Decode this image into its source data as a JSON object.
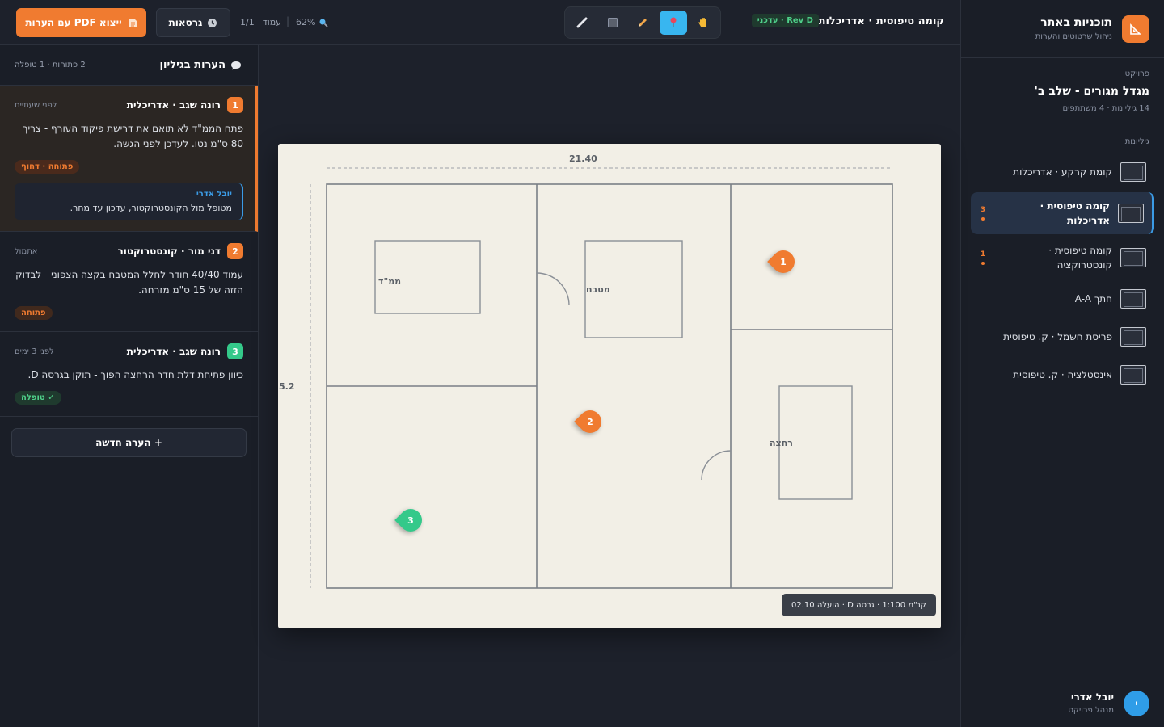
{
  "brand": {
    "title": "תוכניות באתר",
    "subtitle": "ניהול שרטוטים והערות",
    "icon": "blueprint-icon"
  },
  "project": {
    "label": "פרויקט",
    "name": "מגדל מגורים - שלב ב'",
    "meta": "14 גיליונות · 4 משתתפים"
  },
  "sheets_label": "גיליונות",
  "sheets": [
    {
      "name": "קומת קרקע · אדריכלות",
      "count": "",
      "active": false
    },
    {
      "name": "קומה טיפוסית · אדריכלות",
      "count": "3",
      "active": true
    },
    {
      "name": "קומה טיפוסית · קונסטרוקציה",
      "count": "1",
      "active": false
    },
    {
      "name": "חתך A-A",
      "count": "",
      "active": false
    },
    {
      "name": "פריסת חשמל · ק. טיפוסית",
      "count": "",
      "active": false
    },
    {
      "name": "אינסטלציה · ק. טיפוסית",
      "count": "",
      "active": false
    }
  ],
  "user": {
    "initial": "י",
    "name": "יובל אדרי",
    "role": "מנהל פרויקט"
  },
  "topbar": {
    "sheet_title": "קומה טיפוסית · אדריכלות",
    "revision": "Rev D · עדכני",
    "export_label": "ייצוא PDF עם הערות",
    "versions_label": "גרסאות",
    "page_label": "עמוד",
    "page_value": "1/1",
    "zoom": "62%"
  },
  "tools": [
    "hand-tool",
    "pin-tool",
    "pen-tool",
    "rectangle-tool",
    "ruler-tool"
  ],
  "active_tool": "pin-tool",
  "comments_panel": {
    "title": "הערות בגיליון",
    "count": "2 פתוחות · 1 טופלה",
    "new_label": "+ הערה חדשה"
  },
  "comments": [
    {
      "num": "1",
      "color": "#f07b30",
      "author": "רונה שגב · אדריכלית",
      "time": "לפני שעתיים",
      "body": "פתח הממ\"ד לא תואם את דרישת פיקוד העורף - צריך 80 ס\"מ נטו. לעדכן לפני הגשה.",
      "status": "פתוחה · דחוף",
      "status_type": "urgent",
      "reply": {
        "author": "יובל אדרי",
        "body": "מטופל מול הקונסטרוקטור, עדכון עד מחר."
      }
    },
    {
      "num": "2",
      "color": "#f07b30",
      "author": "דני מור · קונסטרוקטור",
      "time": "אתמול",
      "body": "עמוד 40/40 חודר לחלל המטבח בקצה הצפוני - לבדוק הזזה של 15 ס\"מ מזרחה.",
      "status": "פתוחה",
      "status_type": "open"
    },
    {
      "num": "3",
      "color": "#34c98a",
      "author": "רונה שגב · אדריכלית",
      "time": "לפני 3 ימים",
      "body": "כיוון פתיחת דלת חדר הרחצה הפוך - תוקן בגרסה D.",
      "status": "✓ טופלה",
      "status_type": "done"
    }
  ],
  "drawing": {
    "dim_width": "21.40",
    "dim_height": "5.2",
    "rooms": {
      "safe_room": "ממ\"ד",
      "kitchen": "מטבח",
      "bathroom": "רחצה"
    },
    "scale_note": "קנ\"מ 1:100 · גרסה D · הועלה 02.10",
    "pins": [
      {
        "num": "1",
        "color": "#f07b30"
      },
      {
        "num": "2",
        "color": "#f07b30"
      },
      {
        "num": "3",
        "color": "#34c98a"
      }
    ]
  }
}
